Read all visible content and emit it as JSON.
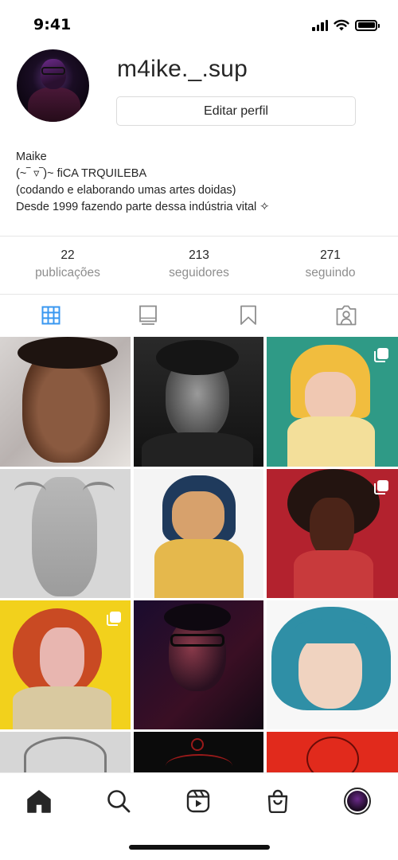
{
  "status_bar": {
    "time": "9:41"
  },
  "profile": {
    "username": "m4ike._.sup",
    "edit_button": "Editar perfil",
    "bio": {
      "name": "Maike",
      "line1": "(~‾ ▿‾)~ fiCA TRQUILEBA",
      "line2": "(codando e elaborando umas artes doidas)",
      "line3": "Desde 1999 fazendo parte dessa indústria vital ✧"
    }
  },
  "stats": [
    {
      "count": "22",
      "label": "publicações"
    },
    {
      "count": "213",
      "label": "seguidores"
    },
    {
      "count": "271",
      "label": "seguindo"
    }
  ],
  "tabs": [
    {
      "name": "grid",
      "icon": "grid-icon",
      "active": true
    },
    {
      "name": "igtv",
      "icon": "tv-icon",
      "active": false
    },
    {
      "name": "saved",
      "icon": "bookmark-icon",
      "active": false
    },
    {
      "name": "tagged",
      "icon": "tagged-person-icon",
      "active": false
    }
  ],
  "posts": [
    {
      "description": "selfie on floral pillow",
      "multi": false
    },
    {
      "description": "black and white portrait",
      "multi": false
    },
    {
      "description": "digital painting blonde girl on teal",
      "multi": true
    },
    {
      "description": "pencil sketch horned creature",
      "multi": false
    },
    {
      "description": "coraline illustration",
      "multi": false
    },
    {
      "description": "portrait woman afro on red",
      "multi": true
    },
    {
      "description": "painting redhead on yellow",
      "multi": true
    },
    {
      "description": "portrait with glasses in red light",
      "multi": false
    },
    {
      "description": "painting blue haired girl",
      "multi": false
    },
    {
      "description": "sketch horned skull",
      "multi": false
    },
    {
      "description": "dark red artwork",
      "multi": false
    },
    {
      "description": "red line artwork",
      "multi": false
    }
  ],
  "bottom_nav": [
    {
      "name": "home",
      "icon": "home-icon"
    },
    {
      "name": "search",
      "icon": "search-icon"
    },
    {
      "name": "reels",
      "icon": "reels-icon"
    },
    {
      "name": "shop",
      "icon": "shop-icon"
    },
    {
      "name": "profile",
      "icon": "profile-avatar-icon"
    }
  ],
  "colors": {
    "active_tab": "#3897f0",
    "text": "#262626",
    "secondary_text": "#8e8e8e",
    "border": "#dbdbdb"
  }
}
